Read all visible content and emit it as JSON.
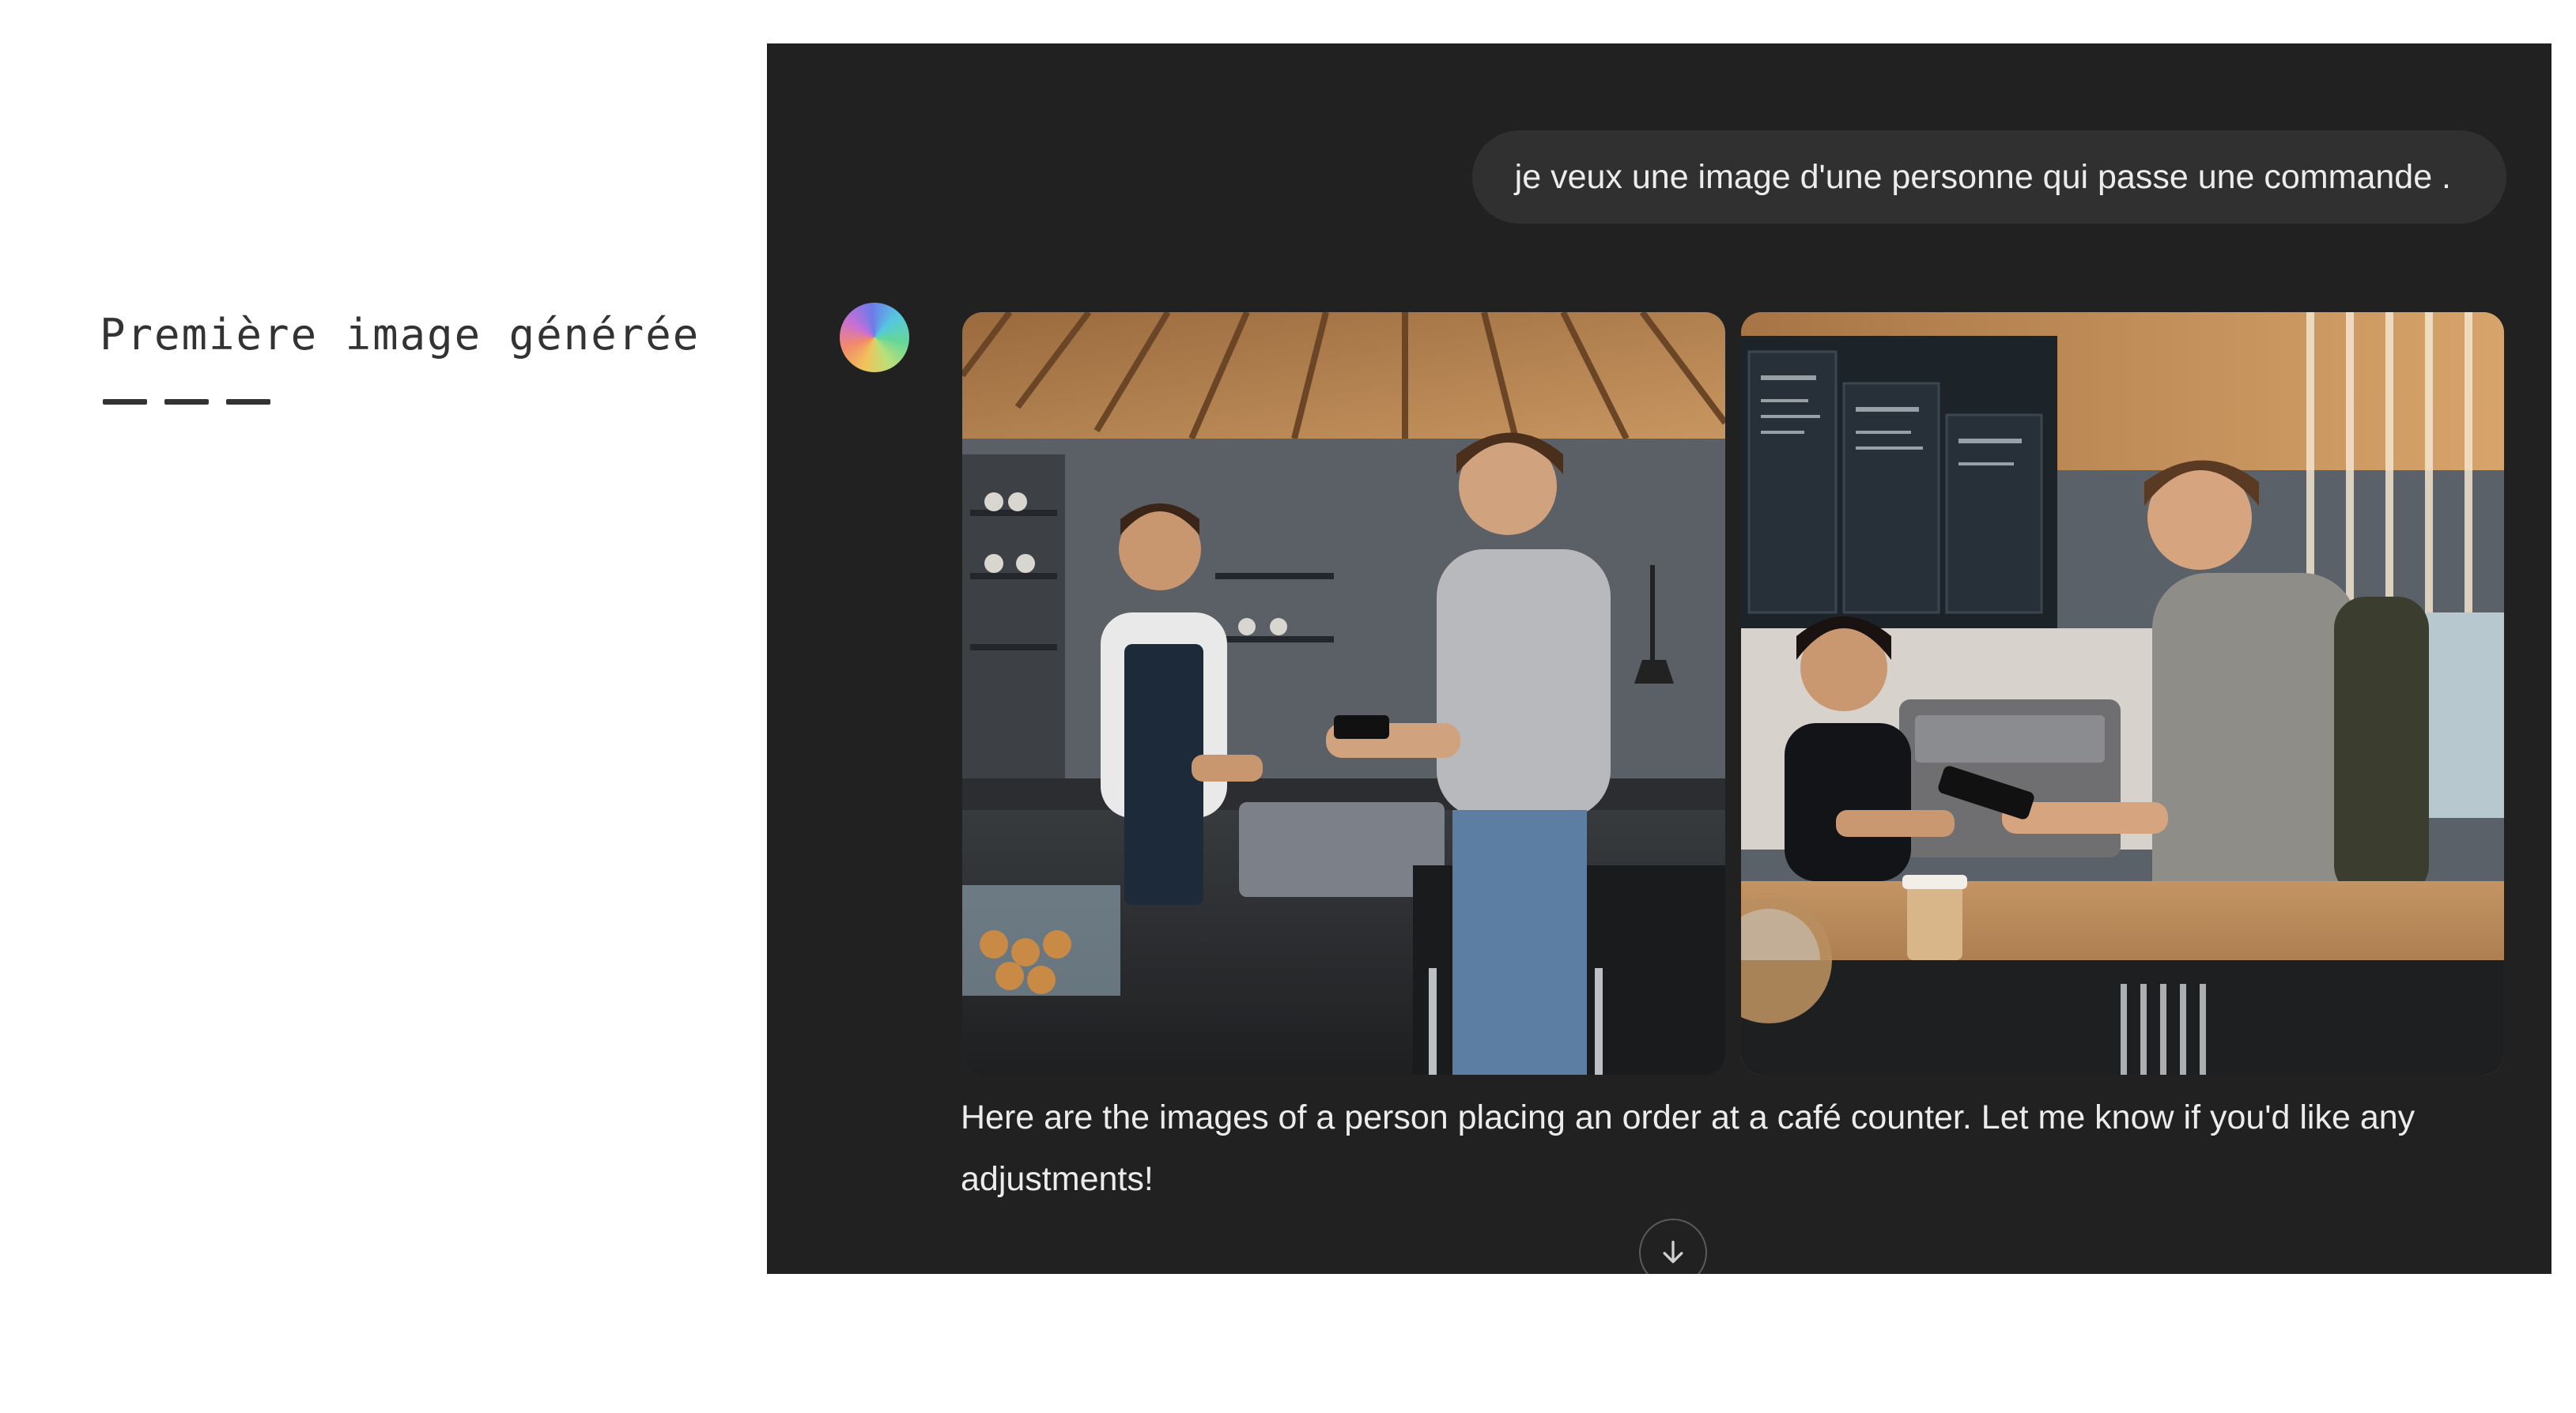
{
  "slide": {
    "title": "Première image générée"
  },
  "chat": {
    "user_message": "je veux une image d'une personne qui passe une commande .",
    "assistant_avatar_icon": "assistant-avatar-icon",
    "images": [
      {
        "name": "generated-image-1"
      },
      {
        "name": "generated-image-2"
      }
    ],
    "assistant_message": "Here are the images of a person placing an order at a café counter. Let me know if you'd like any adjustments!",
    "scroll_button_icon": "arrow-down-icon"
  },
  "colors": {
    "chat_background": "#212121",
    "user_bubble": "#303030",
    "text": "#ececec"
  }
}
